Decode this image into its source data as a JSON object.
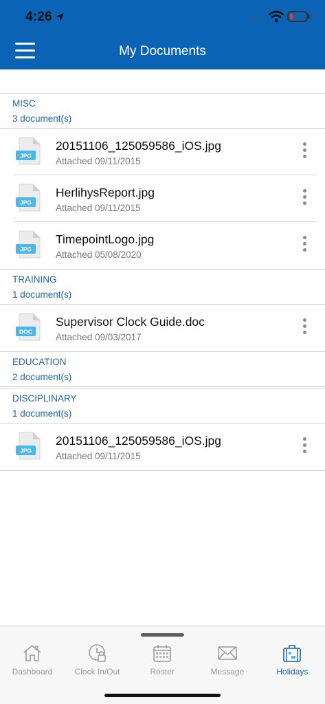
{
  "status": {
    "time": "4:26"
  },
  "header": {
    "title": "My Documents"
  },
  "colors": {
    "brand": "#0a63b4",
    "section_text": "#1d64ad",
    "file_icon_accent": "#4db6e8"
  },
  "sections": [
    {
      "title": "MISC",
      "count": "3 document(s)",
      "docs": [
        {
          "type": "JPG",
          "name": "20151106_125059586_iOS.jpg",
          "date": "Attached 09/11/2015"
        },
        {
          "type": "JPG",
          "name": "HerlihysReport.jpg",
          "date": "Attached 09/11/2015"
        },
        {
          "type": "JPG",
          "name": "TimepointLogo.jpg",
          "date": "Attached 05/08/2020"
        }
      ]
    },
    {
      "title": "TRAINING",
      "count": "1 document(s)",
      "docs": [
        {
          "type": "DOC",
          "name": "Supervisor Clock Guide.doc",
          "date": "Attached 09/03/2017"
        }
      ]
    },
    {
      "title": "EDUCATION",
      "count": "2 document(s)",
      "docs": []
    },
    {
      "title": "DISCIPLINARY",
      "count": "1 document(s)",
      "docs": [
        {
          "type": "JPG",
          "name": "20151106_125059586_iOS.jpg",
          "date": "Attached 09/11/2015"
        }
      ]
    }
  ],
  "tabs": [
    {
      "label": "Dashboard",
      "icon": "home-icon",
      "active": false
    },
    {
      "label": "Clock In/Out",
      "icon": "clock-icon",
      "active": false
    },
    {
      "label": "Roster",
      "icon": "calendar-icon",
      "active": false
    },
    {
      "label": "Message",
      "icon": "envelope-icon",
      "active": false
    },
    {
      "label": "Holidays",
      "icon": "suitcase-icon",
      "active": true
    }
  ]
}
